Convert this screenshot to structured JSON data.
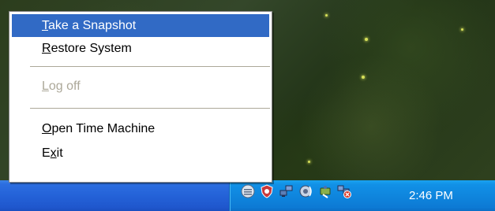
{
  "context_menu": {
    "items": [
      {
        "label_before": "",
        "mnemonic": "T",
        "label_after": "ake a Snapshot",
        "state": "highlighted"
      },
      {
        "label_before": "",
        "mnemonic": "R",
        "label_after": "estore System",
        "state": "normal"
      },
      {
        "label_before": "",
        "mnemonic": "L",
        "label_after": "og off",
        "state": "disabled"
      },
      {
        "label_before": "",
        "mnemonic": "O",
        "label_after": "pen Time Machine",
        "state": "normal"
      },
      {
        "label_before": "E",
        "mnemonic": "x",
        "label_after": "it",
        "state": "normal"
      }
    ]
  },
  "taskbar": {
    "tray_icons": [
      "messenger-icon",
      "security-alert-icon",
      "network-icon",
      "volume-icon",
      "safely-remove-hardware-icon",
      "network-disconnected-icon"
    ],
    "clock": "2:46 PM"
  },
  "colors": {
    "menu_highlight": "#316ac5",
    "taskbar_blue": "#2462d8",
    "tray_blue": "#0f86de",
    "disabled_text": "#aca899"
  }
}
